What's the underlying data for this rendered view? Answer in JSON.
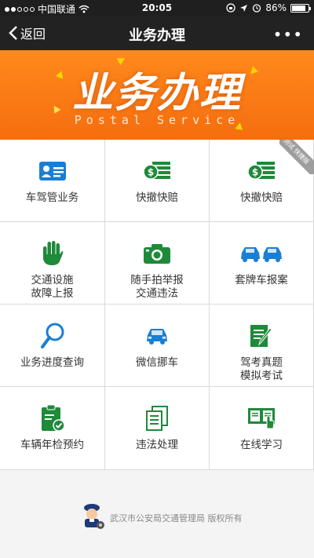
{
  "status_bar": {
    "carrier": "中国联通",
    "time": "20:05",
    "battery": "86%",
    "battery_level": 0.86
  },
  "nav": {
    "back_label": "返回",
    "title": "业务办理",
    "more_label": "•••"
  },
  "banner": {
    "title": "业务办理",
    "subtitle": "Postal Service"
  },
  "test_badge": "测试 快捷版",
  "services": [
    {
      "label": "车驾管业务",
      "icon": "id-card-icon"
    },
    {
      "label": "快撤快赔",
      "icon": "money-stack-icon"
    },
    {
      "label": "快撤快赔",
      "icon": "money-stack-icon"
    },
    {
      "label": "交通设施\n故障上报",
      "icon": "hand-icon"
    },
    {
      "label": "随手拍举报\n交通违法",
      "icon": "camera-icon"
    },
    {
      "label": "套牌车报案",
      "icon": "two-cars-icon"
    },
    {
      "label": "业务进度查询",
      "icon": "magnifier-icon"
    },
    {
      "label": "微信挪车",
      "icon": "car-icon"
    },
    {
      "label": "驾考真题\n模拟考试",
      "icon": "exam-paper-icon"
    },
    {
      "label": "车辆年检预约",
      "icon": "clipboard-check-icon"
    },
    {
      "label": "违法处理",
      "icon": "documents-icon"
    },
    {
      "label": "在线学习",
      "icon": "book-reader-icon"
    }
  ],
  "footer": {
    "copyright": "武汉市公安局交通管理局  版权所有"
  },
  "colors": {
    "accent_blue": "#1a7fd4",
    "accent_green": "#1e8a3a",
    "banner_orange": "#f56d0f",
    "nav_bg": "#222222"
  }
}
